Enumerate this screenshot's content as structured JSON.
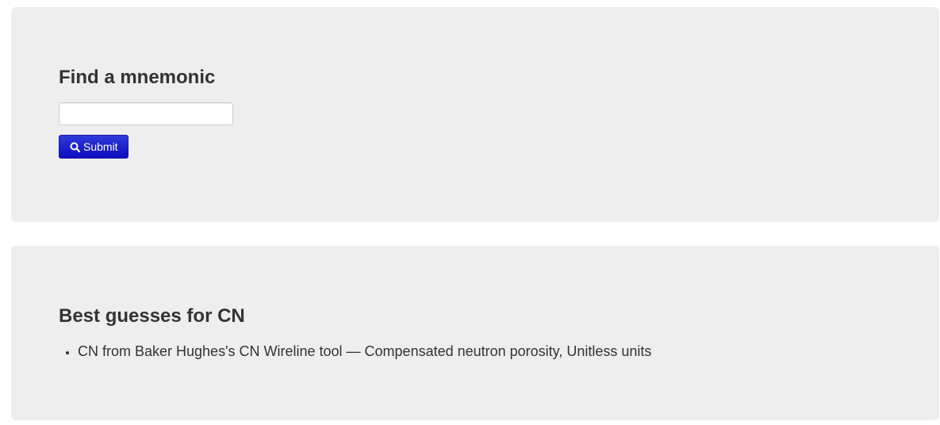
{
  "search": {
    "title": "Find a mnemonic",
    "input_value": "",
    "input_placeholder": "",
    "submit_label": "Submit"
  },
  "results": {
    "title": "Best guesses for CN",
    "items": [
      "CN from Baker Hughes's CN Wireline tool — Compensated neutron porosity, Unitless units"
    ]
  },
  "colors": {
    "panel_background": "#eeeeee",
    "button_primary": "#0d0dbf",
    "text": "#333333"
  }
}
